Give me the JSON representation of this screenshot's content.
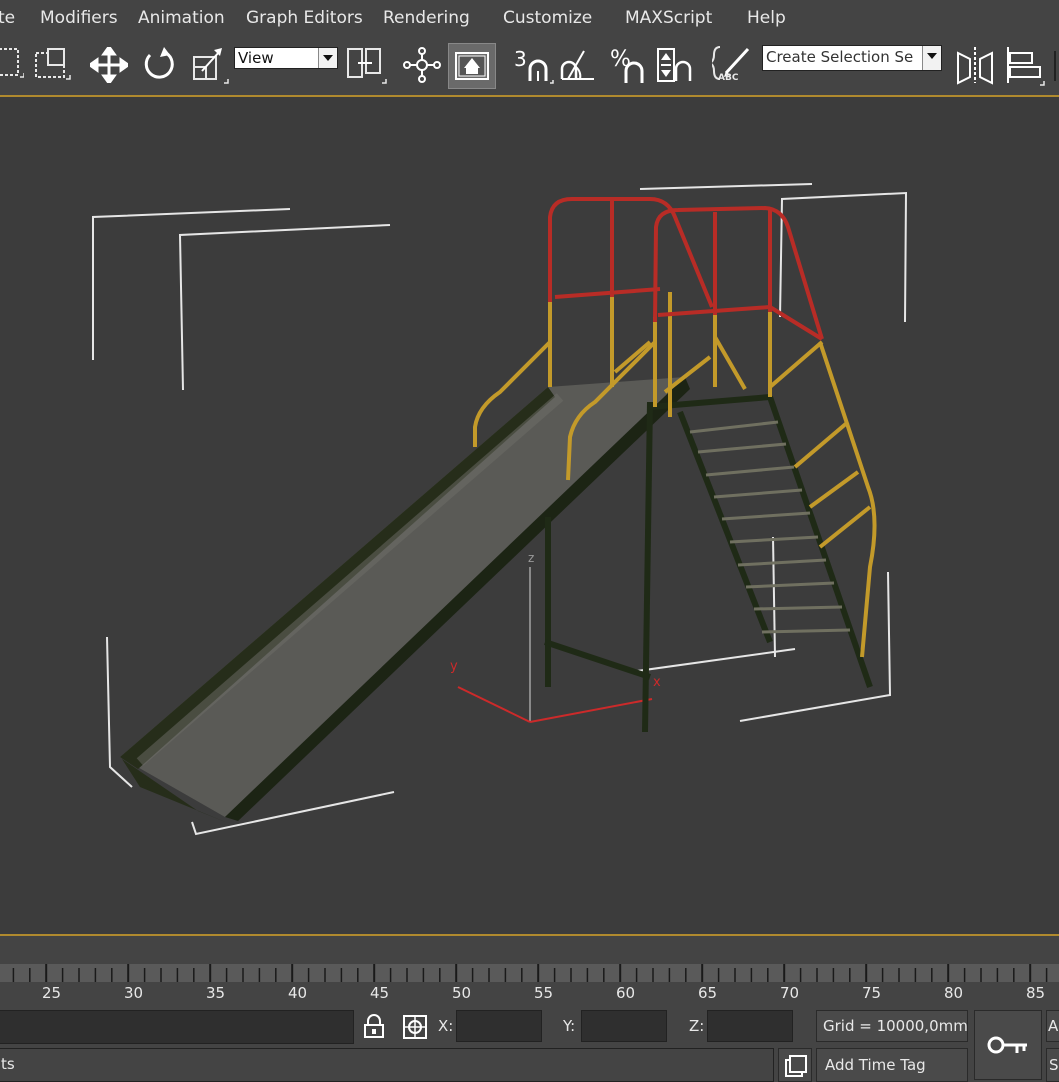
{
  "menu": {
    "items": [
      "te",
      "Modifiers",
      "Animation",
      "Graph Editors",
      "Rendering",
      "Customize",
      "MAXScript",
      "Help"
    ]
  },
  "toolbar": {
    "reference_coord_value": "View",
    "selection_set_placeholder": "Create Selection Se",
    "snap_3d_label": "3",
    "percent_snap_label": "%",
    "abc_label": "ABC"
  },
  "viewport": {
    "axis_x": "x",
    "axis_y": "y",
    "axis_z": "z"
  },
  "timeline": {
    "ticks": [
      "25",
      "30",
      "35",
      "40",
      "45",
      "50",
      "55",
      "60",
      "65",
      "70",
      "75",
      "80",
      "85"
    ]
  },
  "status": {
    "prompt_text": "ts",
    "x_label": "X:",
    "y_label": "Y:",
    "z_label": "Z:",
    "x_value": "",
    "y_value": "",
    "z_value": "",
    "grid_text": "Grid = 10000,0mm",
    "add_time_tag": "Add Time Tag",
    "right_edge_top": "A",
    "right_edge_bottom": "S"
  },
  "colors": {
    "ui_bg": "#444444",
    "viewport_bg": "#3c3c3c",
    "viewport_border": "#b08a2e",
    "railing_red": "#b82c26",
    "railing_yellow": "#c39a2a",
    "frame_green": "#1f2a16",
    "slide_surface": "#5a5a56",
    "axis_red": "#cc2a2a"
  }
}
